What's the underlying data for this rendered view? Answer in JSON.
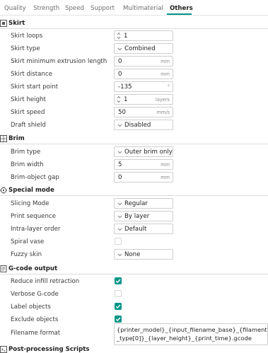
{
  "tabs": [
    {
      "label": "Quality"
    },
    {
      "label": "Strength"
    },
    {
      "label": "Speed"
    },
    {
      "label": "Support"
    },
    {
      "label": "Multimaterial"
    },
    {
      "label": "Others",
      "active": true
    }
  ],
  "accent_color": "#009688",
  "sections": {
    "skirt": {
      "title": "Skirt",
      "icon": "skirt-icon",
      "rows": {
        "loops": {
          "label": "Skirt loops",
          "value": "1"
        },
        "type": {
          "label": "Skirt type",
          "value": "Combined"
        },
        "min_length": {
          "label": "Skirt minimum extrusion length",
          "value": "0",
          "unit": "mm"
        },
        "distance": {
          "label": "Skirt distance",
          "value": "0",
          "unit": "mm"
        },
        "start_point": {
          "label": "Skirt start point",
          "value": "-135",
          "unit": "°"
        },
        "height": {
          "label": "Skirt height",
          "value": "1",
          "unit": "layers"
        },
        "speed": {
          "label": "Skirt speed",
          "value": "50",
          "unit": "mm/s"
        },
        "draft_shield": {
          "label": "Draft shield",
          "value": "Disabled"
        }
      }
    },
    "brim": {
      "title": "Brim",
      "icon": "brim-icon",
      "rows": {
        "type": {
          "label": "Brim type",
          "value": "Outer brim only"
        },
        "width": {
          "label": "Brim width",
          "value": "5",
          "unit": "mm"
        },
        "gap": {
          "label": "Brim-object gap",
          "value": "0",
          "unit": "mm"
        }
      }
    },
    "special": {
      "title": "Special mode",
      "icon": "special-mode-icon",
      "rows": {
        "slicing_mode": {
          "label": "Slicing Mode",
          "value": "Regular"
        },
        "print_sequence": {
          "label": "Print sequence",
          "value": "By layer"
        },
        "intra_layer": {
          "label": "Intra-layer order",
          "value": "Default"
        },
        "spiral_vase": {
          "label": "Spiral vase",
          "checked": false
        },
        "fuzzy_skin": {
          "label": "Fuzzy skin",
          "value": "None"
        }
      }
    },
    "gcode": {
      "title": "G-code output",
      "icon": "gcode-output-icon",
      "rows": {
        "reduce_infill": {
          "label": "Reduce infill retraction",
          "checked": true
        },
        "verbose": {
          "label": "Verbose G-code",
          "checked": false
        },
        "label_objects": {
          "label": "Label objects",
          "checked": true
        },
        "exclude_objects": {
          "label": "Exclude objects",
          "checked": true
        },
        "filename_format": {
          "label": "Filename format",
          "value": "{printer_model}_{input_filename_base}_{filament_type[0]}_{layer_height}_{print_time}.gcode"
        }
      }
    },
    "post": {
      "title": "Post-processing Scripts",
      "icon": "post-processing-icon"
    }
  }
}
